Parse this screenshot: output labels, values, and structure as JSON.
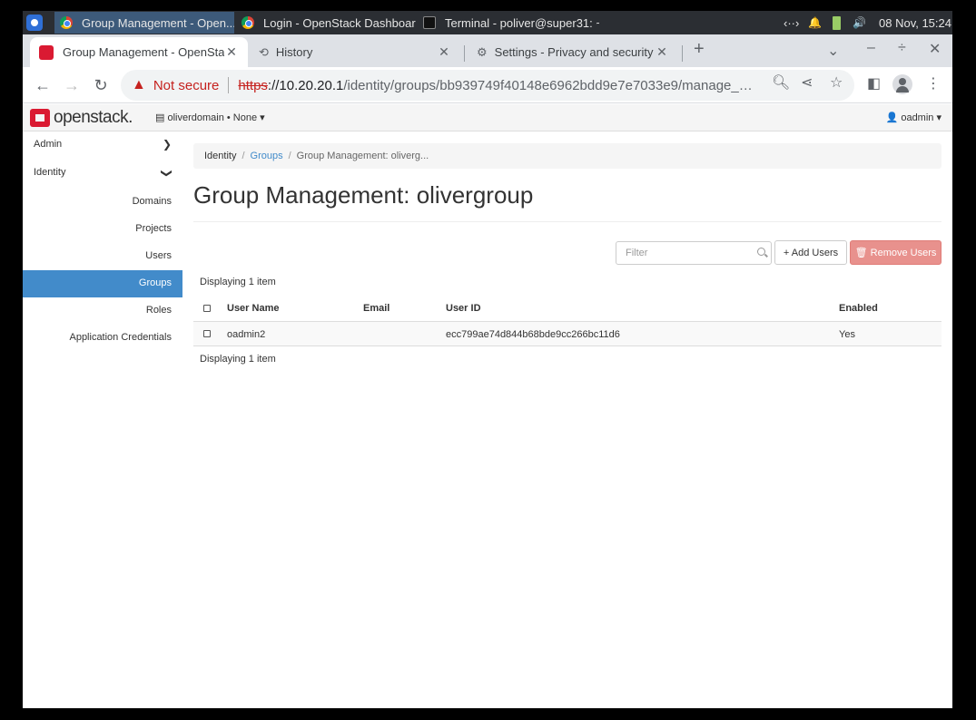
{
  "taskbar": {
    "tasks": [
      {
        "label": "Group Management - Open..."
      },
      {
        "label": "Login - OpenStack Dashboar..."
      },
      {
        "label": "Terminal - poliver@super31: ~"
      }
    ],
    "tray": {
      "network": "‹··›",
      "bell": "🔔",
      "volume": "🔊",
      "datetime": "08 Nov, 15:24"
    }
  },
  "browser": {
    "tabs": [
      {
        "label": "Group Management - OpenSta"
      },
      {
        "label": "History"
      },
      {
        "label": "Settings - Privacy and security"
      }
    ],
    "new_tab": "+",
    "address": {
      "warning": "Not secure",
      "scheme": "https",
      "host": "://10.20.20.1",
      "path": "/identity/groups/bb939749f40148e6962bdd9e7e7033e9/manage_m..."
    }
  },
  "header": {
    "logo": "openstack.",
    "domain_menu": "▤ oliverdomain • None ▾",
    "user_menu": "👤 oadmin ▾"
  },
  "sidebar": {
    "sections": [
      {
        "label": "Admin"
      },
      {
        "label": "Identity"
      }
    ],
    "items": [
      {
        "label": "Domains"
      },
      {
        "label": "Projects"
      },
      {
        "label": "Users"
      },
      {
        "label": "Groups"
      },
      {
        "label": "Roles"
      },
      {
        "label": "Application Credentials"
      }
    ]
  },
  "breadcrumb": {
    "items": [
      {
        "label": "Identity"
      },
      {
        "label": "Groups"
      },
      {
        "label": "Group Management: oliverg..."
      }
    ]
  },
  "page": {
    "title": "Group Management: olivergroup",
    "filter_placeholder": "Filter",
    "add_users": "+ Add Users",
    "remove_users": "🗑 Remove Users",
    "count_top": "Displaying 1 item",
    "count_bottom": "Displaying 1 item"
  },
  "table": {
    "columns": [
      "User Name",
      "Email",
      "User ID",
      "Enabled"
    ],
    "rows": [
      [
        "oadmin2",
        "",
        "ecc799ae74d844b68bde9cc266bc11d6",
        "Yes"
      ]
    ]
  },
  "colors": {
    "active_nav": "#428bca",
    "remove_button": "#e8918d",
    "brand": "#da1a32",
    "insecure": "#c5221f"
  }
}
